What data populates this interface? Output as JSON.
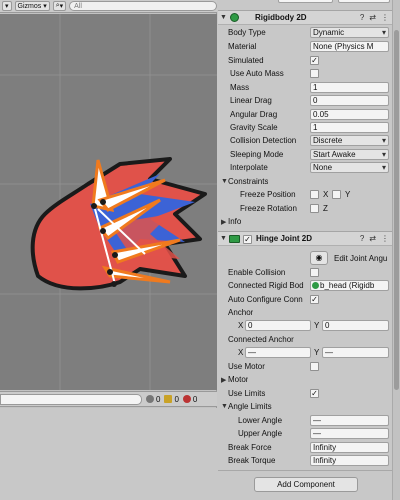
{
  "scene": {
    "toolbar": {
      "gizmos_label": "Gizmos",
      "search_placeholder": "All"
    },
    "console": {
      "info_count": "0",
      "warning_count": "0",
      "error_count": "0"
    }
  },
  "rigidbody2d": {
    "title": "Rigidbody 2D",
    "body_type": {
      "label": "Body Type",
      "value": "Dynamic"
    },
    "material": {
      "label": "Material",
      "value": "None (Physics M"
    },
    "simulated": {
      "label": "Simulated",
      "checked": true
    },
    "use_auto_mass": {
      "label": "Use Auto Mass",
      "checked": false
    },
    "mass": {
      "label": "Mass",
      "value": "1"
    },
    "linear_drag": {
      "label": "Linear Drag",
      "value": "0"
    },
    "angular_drag": {
      "label": "Angular Drag",
      "value": "0.05"
    },
    "gravity_scale": {
      "label": "Gravity Scale",
      "value": "1"
    },
    "collision_detection": {
      "label": "Collision Detection",
      "value": "Discrete"
    },
    "sleeping_mode": {
      "label": "Sleeping Mode",
      "value": "Start Awake"
    },
    "interpolate": {
      "label": "Interpolate",
      "value": "None"
    },
    "constraints": {
      "label": "Constraints",
      "freeze_position": {
        "label": "Freeze Position",
        "x": "X",
        "y": "Y"
      },
      "freeze_rotation": {
        "label": "Freeze Rotation",
        "z": "Z"
      }
    },
    "info": {
      "label": "Info"
    }
  },
  "hinge_joint2d": {
    "title": "Hinge Joint 2D",
    "edit_label": "Edit Joint Angu",
    "enable_collision": {
      "label": "Enable Collision",
      "checked": false
    },
    "connected_rigid_body": {
      "label": "Connected Rigid Bod",
      "value": "b_head (Rigidb"
    },
    "auto_configure": {
      "label": "Auto Configure Conn",
      "checked": true
    },
    "anchor": {
      "label": "Anchor",
      "x_label": "X",
      "x": "0",
      "y_label": "Y",
      "y": "0"
    },
    "connected_anchor": {
      "label": "Connected Anchor",
      "x_label": "X",
      "x": "—",
      "y_label": "Y",
      "y": "—"
    },
    "use_motor": {
      "label": "Use Motor",
      "checked": false
    },
    "motor": {
      "label": "Motor"
    },
    "use_limits": {
      "label": "Use Limits",
      "checked": true
    },
    "angle_limits": {
      "label": "Angle Limits",
      "lower": {
        "label": "Lower Angle",
        "value": "—"
      },
      "upper": {
        "label": "Upper Angle",
        "value": "—"
      }
    },
    "break_force": {
      "label": "Break Force",
      "value": "Infinity"
    },
    "break_torque": {
      "label": "Break Torque",
      "value": "Infinity"
    }
  },
  "add_component_label": "Add Component",
  "colors": {
    "scene_background": "#7e7e7e",
    "character_fill": "#e0524a",
    "character_blue": "#3c63d6",
    "gizmo_orange": "#f07a1e",
    "inspector_background": "#c8c8c8"
  }
}
